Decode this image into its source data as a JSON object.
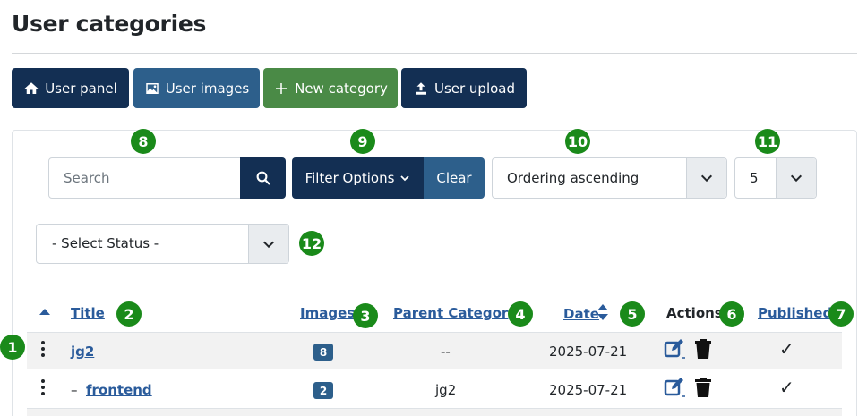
{
  "page": {
    "title": "User categories"
  },
  "toolbar": {
    "user_panel": "User panel",
    "user_images": "User images",
    "new_category": "New category",
    "user_upload": "User upload"
  },
  "filters": {
    "search_placeholder": "Search",
    "filter_options": "Filter Options",
    "clear": "Clear",
    "ordering": "Ordering ascending",
    "limit": "5",
    "status": "- Select Status -"
  },
  "markers": {
    "m1": "1",
    "m2": "2",
    "m3": "3",
    "m4": "4",
    "m5": "5",
    "m6": "6",
    "m7": "7",
    "m8": "8",
    "m9": "9",
    "m10": "10",
    "m11": "11",
    "m12": "12"
  },
  "table": {
    "headers": {
      "title": "Title",
      "images": "Images",
      "parent": "Parent Category",
      "date": "Date",
      "actions": "Actions",
      "published": "Published"
    },
    "rows": [
      {
        "title": "jg2",
        "prefix": "",
        "images": "8",
        "parent": "--",
        "date": "2025-07-21",
        "published": "✓"
      },
      {
        "title": "frontend",
        "prefix": "–",
        "images": "2",
        "parent": "jg2",
        "date": "2025-07-21",
        "published": "✓"
      }
    ]
  },
  "colors": {
    "dark_blue": "#132f53",
    "mid_blue": "#2d5f8b",
    "green": "#4a8a46",
    "link": "#2a5b9b",
    "marker_green": "#1a8a1a"
  }
}
